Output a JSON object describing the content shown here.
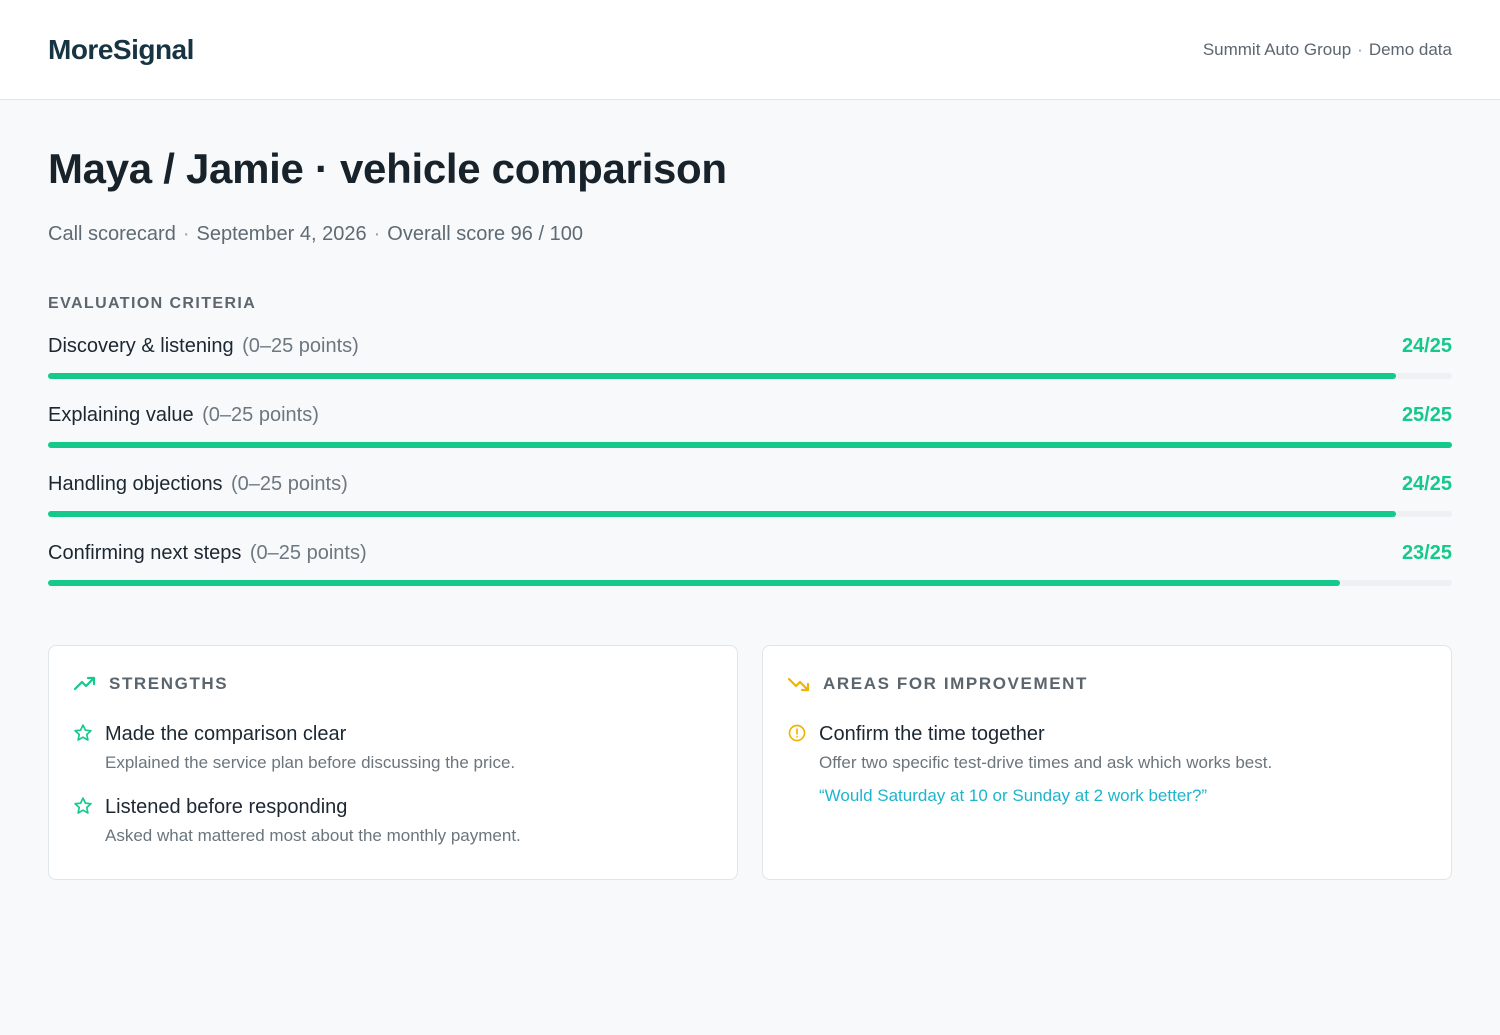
{
  "header": {
    "brand": "MoreSignal",
    "account": "Summit Auto Group",
    "separator": "·",
    "mode": "Demo data"
  },
  "page": {
    "title": "Maya / Jamie · vehicle comparison",
    "meta": {
      "type": "Call scorecard",
      "date": "September 4, 2026",
      "overall": "Overall score 96 / 100",
      "separator": "·"
    }
  },
  "criteria": {
    "label": "EVALUATION CRITERIA",
    "max": 25,
    "items": [
      {
        "name": "Discovery & listening",
        "range": "(0–25 points)",
        "score_text": "24/25",
        "score": 24
      },
      {
        "name": "Explaining value",
        "range": "(0–25 points)",
        "score_text": "25/25",
        "score": 25
      },
      {
        "name": "Handling objections",
        "range": "(0–25 points)",
        "score_text": "24/25",
        "score": 24
      },
      {
        "name": "Confirming next steps",
        "range": "(0–25 points)",
        "score_text": "23/25",
        "score": 23
      }
    ]
  },
  "strengths": {
    "title": "STRENGTHS",
    "icon": "trending-up-icon",
    "items": [
      {
        "icon": "star-icon",
        "title": "Made the comparison clear",
        "desc": "Explained the service plan before discussing the price."
      },
      {
        "icon": "star-icon",
        "title": "Listened before responding",
        "desc": "Asked what mattered most about the monthly payment."
      }
    ]
  },
  "improvements": {
    "title": "AREAS FOR IMPROVEMENT",
    "icon": "trending-down-icon",
    "items": [
      {
        "icon": "info-circle-icon",
        "title": "Confirm the time together",
        "desc": "Offer two specific test-drive times and ask which works best.",
        "quote": "“Would Saturday at 10 or Sunday at 2 work better?”"
      }
    ]
  },
  "colors": {
    "accent_green": "#14c98a",
    "warning_yellow": "#f0b400",
    "quote_cyan": "#1db5cc",
    "brand_navy": "#163442"
  }
}
